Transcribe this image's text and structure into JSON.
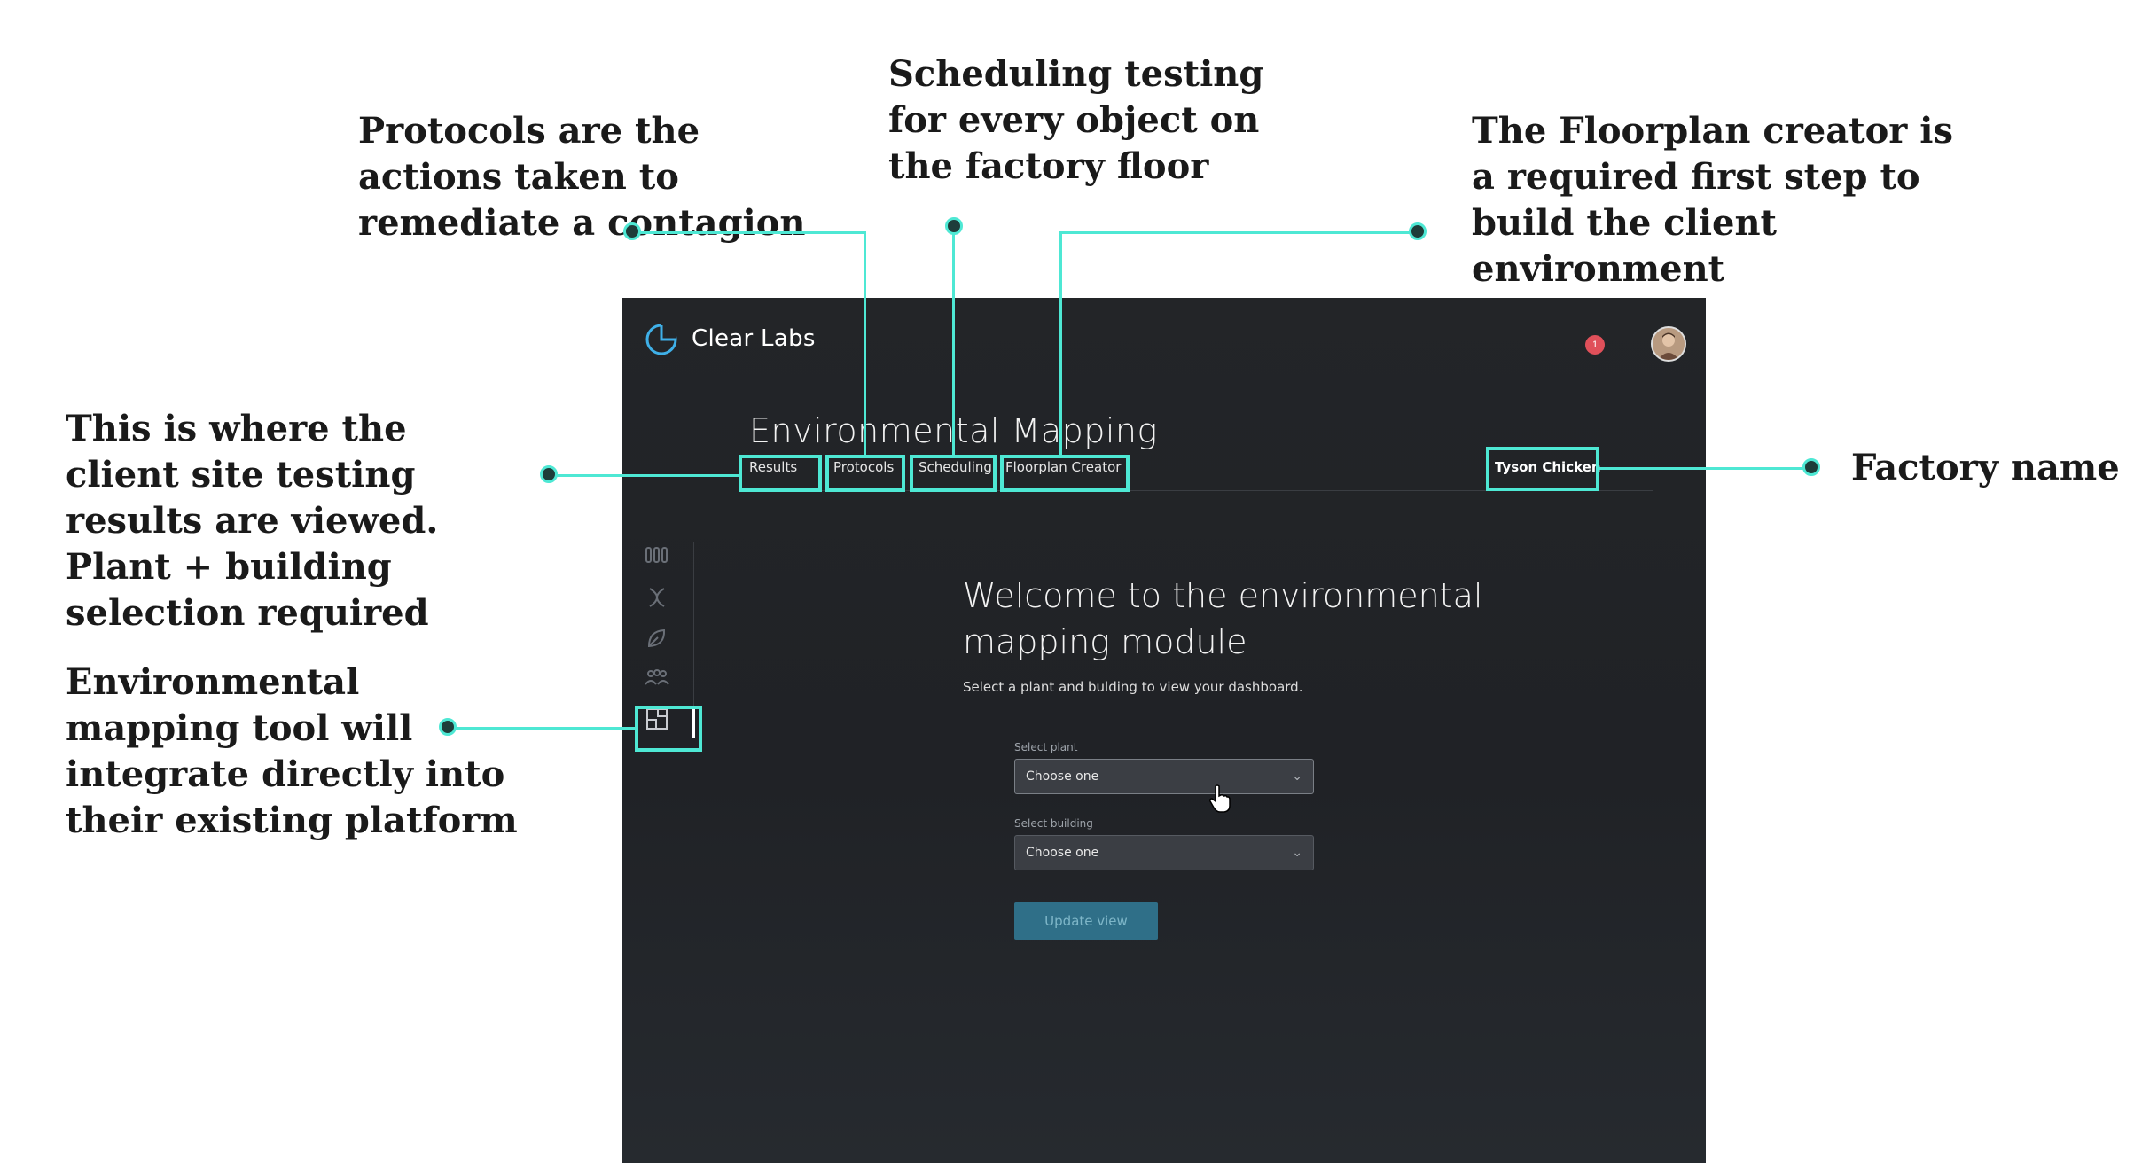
{
  "annotations": {
    "protocols": "Protocols are the actions taken to remediate a contagion",
    "scheduling": "Scheduling testing for every object on the factory floor",
    "floorplan": "The Floorplan creator is a required first step to build the client environment",
    "results": "This is where the client site testing results are viewed. Plant + building selection required",
    "integration": "Environmental mapping tool will integrate directly into their existing platform",
    "factory": "Factory name"
  },
  "header": {
    "brand": "Clear Labs",
    "notification_count": "1"
  },
  "page": {
    "title": "Environmental Mapping",
    "tabs": [
      "Results",
      "Protocols",
      "Scheduling",
      "Floorplan Creator"
    ],
    "factory_name": "Tyson Chicken"
  },
  "main": {
    "welcome": "Welcome to the environmental mapping module",
    "subtitle": "Select a plant and bulding to view your dashboard.",
    "plant_label": "Select plant",
    "plant_value": "Choose one",
    "building_label": "Select building",
    "building_value": "Choose one",
    "update_button": "Update view"
  },
  "sidebar": {
    "icons": [
      "tubes-icon",
      "dna-icon",
      "leaf-icon",
      "team-icon",
      "floorplan-icon"
    ]
  },
  "colors": {
    "accent": "#4ee8d4",
    "notification": "#e0505a",
    "button": "#2f6f88"
  }
}
